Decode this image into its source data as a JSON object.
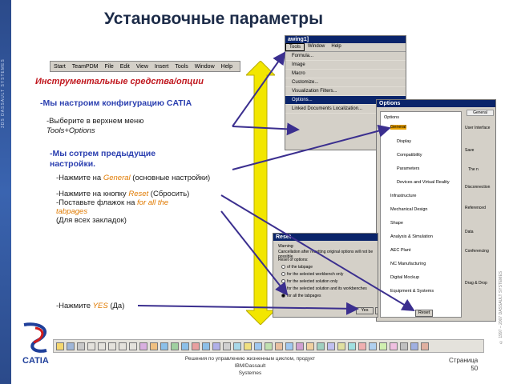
{
  "slide": {
    "title": "Установочные параметры",
    "left_vertical_text": "3DS DASSAULT SYSTEMES",
    "menubar_items": [
      "Start",
      "TeamPDM",
      "File",
      "Edit",
      "View",
      "Insert",
      "Tools",
      "Window",
      "Help"
    ],
    "section_heading": "Инструментальные средства/опции",
    "bullet1": "-Мы настроим конфигурацию CATIA",
    "bullet2_line1": "-Выберите в верхнем меню",
    "bullet2_line2": "Tools+Options",
    "bullet3_line1": "-Мы сотрем предыдущие",
    "bullet3_line2": "настройки.",
    "bullet4_prefix": "-Нажмите на ",
    "bullet4_hl": "General",
    "bullet4_suffix": " (основные настройки)",
    "bullet5_l1_prefix": "-Нажмите на кнопку ",
    "bullet5_l1_hl": "Reset",
    "bullet5_l1_suffix": " (Сбросить)",
    "bullet5_l2_prefix": "-Поставьте флажок на  ",
    "bullet5_l2_hl": "for all the",
    "bullet5_l3_hl": "tabpages",
    "bullet5_l4": "(Для всех закладок)",
    "bullet6_prefix": "-Нажмите ",
    "bullet6_hl": "YES",
    "bullet6_suffix": " (Да)",
    "footer_line1": "Решения по управлению жизненным циклом, продукт IBM/Dassault",
    "footer_line2": "Systemes",
    "page_label": "Страница",
    "page_number": "50",
    "right_vertical_text": "© 1997 – 2007 DASSAULT SYSTEMES",
    "logo_text": "CATIA"
  },
  "tools_window": {
    "title": "awing1]",
    "menu": [
      "Tools",
      "Window",
      "Help"
    ],
    "items": [
      "Formula...",
      "Image",
      "Macro",
      "Customize...",
      "Visualization Filters...",
      "Options...",
      "Linked Documents Localization..."
    ]
  },
  "options_window": {
    "title": "Options",
    "tab": "General",
    "tree": [
      "Options",
      "General",
      "Display",
      "Compatibility",
      "Parameters",
      "Devices and Virtual Reality",
      "Infrastructure",
      "Mechanical Design",
      "Shape",
      "Analysis & Simulation",
      "AEC Plant",
      "NC Manufacturing",
      "Digital Mockup",
      "Equipment & Systems"
    ],
    "side_labels": [
      "User Interface",
      "Save",
      "The n",
      "Disconnection",
      "Referenced",
      "Data",
      "Conferencing",
      "Drag & Drop"
    ],
    "reset_button": "Reset"
  },
  "reset_window": {
    "title": "Reset",
    "warning_label": "Warning:",
    "warning_text": "Cancellation after resetting original options will not be possible",
    "reset_label": "Reset of options:",
    "options": [
      "of the tabpage",
      "for the selected workbench only",
      "for the selected solution only",
      "for the selected solution and its workbenches",
      "for all the tabpages"
    ],
    "yes_button": "Yes",
    "no_button": "No"
  }
}
